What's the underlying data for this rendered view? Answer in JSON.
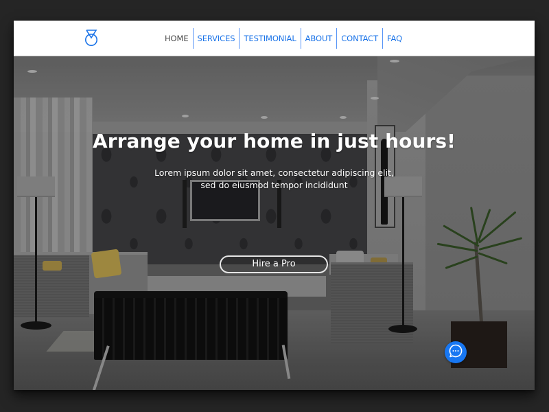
{
  "header": {
    "logo_icon": "medal-icon",
    "nav": [
      {
        "label": "HOME",
        "active": true
      },
      {
        "label": "SERVICES",
        "active": false
      },
      {
        "label": "TESTIMONIAL",
        "active": false
      },
      {
        "label": "ABOUT",
        "active": false
      },
      {
        "label": "CONTACT",
        "active": false
      },
      {
        "label": "FAQ",
        "active": false
      }
    ]
  },
  "hero": {
    "title": "Arrange your home in just hours!",
    "subtitle_line1": "Lorem ipsum dolor sit amet, consectetur adipiscing elit,",
    "subtitle_line2": "sed do eiusmod tempor incididunt",
    "cta_label": "Hire a Pro",
    "background_image": "living-room-interior"
  },
  "chat": {
    "icon": "chat-bubble-icon"
  },
  "colors": {
    "accent": "#1a73e8",
    "nav_active": "#4a4a4a",
    "chat_button": "#1877f2",
    "page_background": "#252525"
  }
}
